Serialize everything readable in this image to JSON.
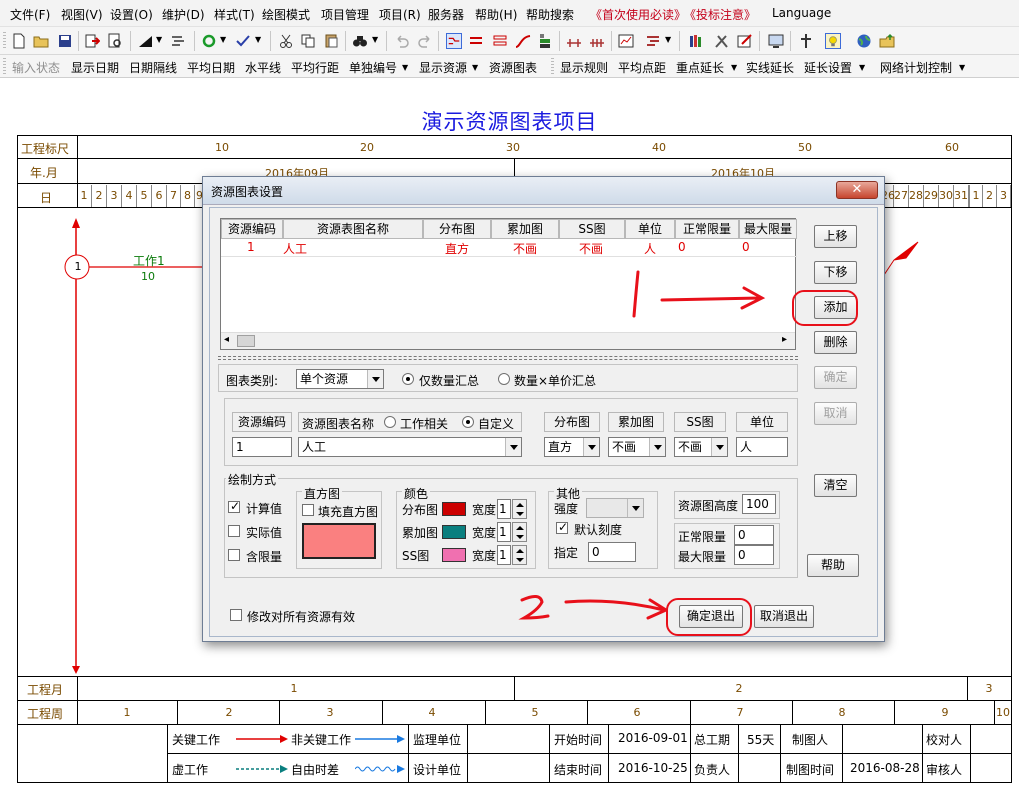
{
  "menu": [
    "文件(F)",
    "视图(V)",
    "设置(O)",
    "维护(D)",
    "样式(T)",
    "绘图模式",
    "项目管理",
    "项目(R)",
    "服务器",
    "帮助(H)",
    "帮助搜索",
    "《首次使用必读》",
    "《投标注意》",
    "Language"
  ],
  "toolbar2": [
    "输入状态",
    "显示日期",
    "日期隔线",
    "平均日期",
    "水平线",
    "平均行距",
    "单独编号",
    "显示资源",
    "资源图表",
    "显示规则",
    "平均点距",
    "重点延长",
    "实线延长",
    "延长设置",
    "网络计划控制"
  ],
  "chart_title": "演示资源图表项目",
  "ruler": {
    "label_ruler": "工程标尺",
    "label_month": "年.月",
    "label_day": "日",
    "ruler_ticks": [
      "10",
      "20",
      "30",
      "40",
      "50",
      "60"
    ],
    "months": [
      "2016年09月",
      "2016年10月"
    ],
    "days_left": [
      "1",
      "2",
      "3",
      "4",
      "5",
      "6",
      "7",
      "8",
      "9"
    ],
    "days_right": [
      "26",
      "27",
      "28",
      "29",
      "30",
      "31",
      "1",
      "2",
      "3"
    ]
  },
  "network": {
    "node1": "1",
    "work1_name": "工作1",
    "work1_duration": "10"
  },
  "bottom": {
    "label_month": "工程月",
    "months": [
      "1",
      "2",
      "3"
    ],
    "label_week": "工程周",
    "weeks": [
      "1",
      "2",
      "3",
      "4",
      "5",
      "6",
      "7",
      "8",
      "9",
      "10"
    ]
  },
  "legend": {
    "key_work": "关键工作",
    "non_key_work": "非关键工作",
    "supervisor": "监理单位",
    "dummy_work": "虚工作",
    "free_float": "自由时差",
    "designer": "设计单位",
    "start_label": "开始时间",
    "start_value": "2016-09-01",
    "duration_label": "总工期",
    "duration_value": "55天",
    "drawer_label": "制图人",
    "checker_label": "校对人",
    "end_label": "结束时间",
    "end_value": "2016-10-25",
    "owner_label": "负责人",
    "draw_time_label": "制图时间",
    "draw_time_value": "2016-08-28",
    "reviewer_label": "审核人"
  },
  "dialog": {
    "title": "资源图表设置",
    "close": "✕",
    "table_headers": [
      "资源编码",
      "资源表图名称",
      "分布图",
      "累加图",
      "SS图",
      "单位",
      "正常限量",
      "最大限量"
    ],
    "table_row": [
      "1",
      "人工",
      "直方",
      "不画",
      "不画",
      "人",
      "0",
      "0"
    ],
    "buttons": {
      "up": "上移",
      "down": "下移",
      "add": "添加",
      "delete": "删除",
      "confirm": "确定",
      "cancel": "取消",
      "clear": "清空",
      "help": "帮助",
      "ok_exit": "确定退出",
      "cancel_exit": "取消退出"
    },
    "chart_type_label": "图表类别:",
    "chart_type_value": "单个资源",
    "radio_qty": "仅数量汇总",
    "radio_qty_price": "数量×单价汇总",
    "code_label": "资源编码",
    "name_label": "资源图表名称",
    "radio_work": "工作相关",
    "radio_custom": "自定义",
    "dist_label": "分布图",
    "cum_label": "累加图",
    "ss_label": "SS图",
    "unit_label": "单位",
    "code_value": "1",
    "name_value": "人工",
    "dist_value": "直方",
    "cum_value": "不画",
    "ss_value": "不画",
    "unit_value": "人",
    "draw_group": "绘制方式",
    "calc_value": "计算值",
    "actual_value": "实际值",
    "with_limit": "含限量",
    "histogram_group": "直方图",
    "fill_histogram": "填充直方图",
    "histogram_fill_color": "#fa8080",
    "color_group": "颜色",
    "color_dist": "分布图",
    "color_cum": "累加图",
    "color_ss": "SS图",
    "width_label": "宽度",
    "width_values": [
      "1",
      "1",
      "1"
    ],
    "dist_color": "#cc0000",
    "cum_color": "#0a7f7f",
    "ss_color": "#f070b0",
    "other_group": "其他",
    "strength_label": "强度",
    "default_scale": "默认刻度",
    "specify_label": "指定",
    "specify_value": "0",
    "height_label": "资源图高度",
    "height_value": "100",
    "normal_limit_label": "正常限量",
    "normal_limit_value": "0",
    "max_limit_label": "最大限量",
    "max_limit_value": "0",
    "apply_all": "修改对所有资源有效"
  },
  "annotations": {
    "step1": "1",
    "step2": "2"
  }
}
